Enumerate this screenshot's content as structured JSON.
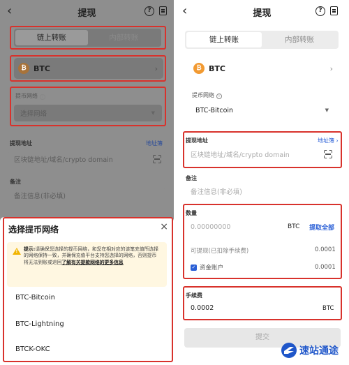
{
  "left": {
    "header": {
      "back_icon": "‹",
      "title": "提现"
    },
    "tabs": [
      "链上转账",
      "内部转账"
    ],
    "coin": {
      "symbol": "BTC",
      "icon_letter": "₿"
    },
    "network": {
      "label": "提币网络",
      "placeholder": "选择网络"
    },
    "address": {
      "label": "提现地址",
      "book_link": "地址簿",
      "placeholder": "区块链地址/域名/crypto domain"
    },
    "memo": {
      "label": "备注",
      "placeholder": "备注信息(非必填)"
    },
    "sheet": {
      "title": "选择提币网络",
      "close": "×",
      "tip_prefix": "提示:",
      "tip_body": "请确保您选择的提币网络，和您在相对应的该笔充值所选择的网络保持一致，并确保充值平台支持您选择的网络，否则提币将无法到账或退回",
      "tip_link": "了解有关提款网络的更多信息",
      "options": [
        "BTC-Bitcoin",
        "BTC-Lightning",
        "BTCK-OKC"
      ]
    }
  },
  "right": {
    "header": {
      "back_icon": "‹",
      "title": "提现"
    },
    "tabs": [
      "链上转账",
      "内部转账"
    ],
    "coin": {
      "symbol": "BTC",
      "icon_letter": "₿"
    },
    "network": {
      "label": "提币网络",
      "value": "BTC-Bitcoin"
    },
    "address": {
      "label": "提现地址",
      "book_link": "地址簿 ›",
      "placeholder": "区块链地址/域名/crypto domain"
    },
    "memo": {
      "label": "备注",
      "placeholder": "备注信息(非必填)"
    },
    "amount": {
      "label": "数量",
      "placeholder": "0.00000000",
      "unit": "BTC",
      "withdraw_all": "提取全部",
      "available_label": "可提现(已扣除手续费)",
      "available_value": "0.0001",
      "funding_label": "资金账户",
      "funding_value": "0.0001"
    },
    "fee": {
      "label": "手续费",
      "value": "0.0002",
      "unit": "BTC"
    },
    "submit": "提交"
  },
  "watermark": {
    "text": "速站通途"
  },
  "colors": {
    "highlight": "#d8322c",
    "accent": "#2a5fd6",
    "btc": "#f29a32",
    "dim": "#8e8e8e"
  }
}
